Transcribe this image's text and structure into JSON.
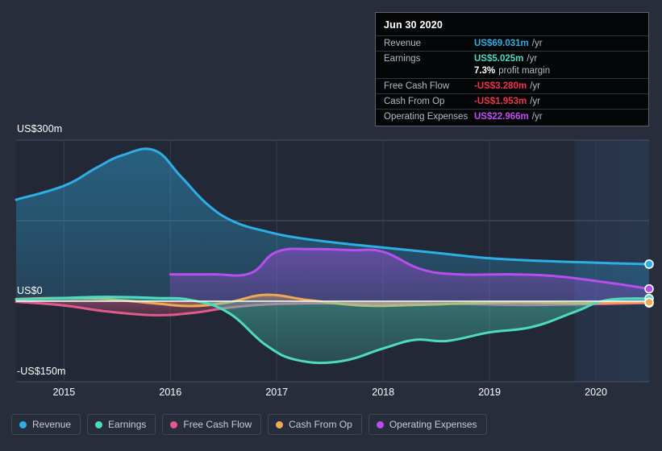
{
  "chart_data": {
    "type": "area",
    "title": "",
    "xlabel": "",
    "ylabel": "",
    "x_tick_labels": [
      "2015",
      "2016",
      "2017",
      "2018",
      "2019",
      "2020"
    ],
    "y_tick_labels": [
      "US$300m",
      "US$0",
      "-US$150m"
    ],
    "ylim": [
      -150,
      300
    ],
    "y_unit": "US$m",
    "grid": true,
    "legend_position": "bottom-left",
    "forecast_region_start": "2019.8",
    "series": [
      {
        "name": "Revenue",
        "color": "#2dafe6",
        "x": [
          2014.55,
          2015.0,
          2015.3,
          2015.55,
          2015.85,
          2016.1,
          2016.35,
          2016.6,
          2016.9,
          2017.2,
          2017.6,
          2018.0,
          2018.5,
          2019.0,
          2019.5,
          2019.8,
          2020.1,
          2020.5
        ],
        "values": [
          189,
          215,
          248,
          272,
          281,
          232,
          180,
          148,
          130,
          118,
          108,
          100,
          90,
          80,
          75,
          73,
          71,
          69.031
        ]
      },
      {
        "name": "Earnings",
        "color": "#4ddbc0",
        "x": [
          2014.55,
          2015.0,
          2015.4,
          2015.85,
          2016.2,
          2016.55,
          2016.9,
          2017.2,
          2017.6,
          2018.0,
          2018.3,
          2018.6,
          2019.0,
          2019.4,
          2019.8,
          2020.1,
          2020.5
        ],
        "values": [
          3,
          6,
          8,
          6,
          2,
          -22,
          -82,
          -110,
          -112,
          -88,
          -72,
          -74,
          -58,
          -48,
          -20,
          2,
          5.025
        ]
      },
      {
        "name": "Free Cash Flow",
        "color": "#e05a8c",
        "x": [
          2014.55,
          2015.0,
          2015.4,
          2015.85,
          2016.2,
          2016.55,
          2016.9,
          2017.3,
          2017.8,
          2018.3,
          2018.8,
          2019.3,
          2019.8,
          2020.1,
          2020.5
        ],
        "values": [
          -1,
          -8,
          -19,
          -26,
          -22,
          -12,
          -6,
          -4,
          -4,
          -4,
          -5,
          -7,
          -6,
          -5,
          -3.28
        ]
      },
      {
        "name": "Cash From Op",
        "color": "#eeaa55",
        "x": [
          2014.55,
          2015.0,
          2015.4,
          2015.85,
          2016.2,
          2016.55,
          2016.9,
          2017.3,
          2017.8,
          2018.3,
          2018.8,
          2019.3,
          2019.8,
          2020.1,
          2020.5
        ],
        "values": [
          4,
          6,
          4,
          -4,
          -9,
          -2,
          12,
          2,
          -8,
          -7,
          -4,
          -2,
          -4,
          -3,
          -1.953
        ]
      },
      {
        "name": "Operating Expenses",
        "color": "#b84df0",
        "x": [
          2016.0,
          2016.4,
          2016.75,
          2017.0,
          2017.35,
          2017.7,
          2018.0,
          2018.35,
          2018.7,
          2019.2,
          2019.6,
          2020.1,
          2020.5
        ],
        "values": [
          50,
          50,
          52,
          92,
          97,
          95,
          92,
          60,
          50,
          50,
          47,
          35,
          22.966
        ]
      }
    ]
  },
  "tooltip": {
    "date": "Jun 30 2020",
    "rows": [
      {
        "label": "Revenue",
        "value": "US$69.031m",
        "unit": "/yr",
        "color": "#2dafe6"
      },
      {
        "label": "Earnings",
        "value": "US$5.025m",
        "unit": "/yr",
        "color": "#4ddbc0"
      },
      {
        "label": "",
        "value": "7.3%",
        "unit": "profit margin",
        "color": "#ffffff"
      },
      {
        "label": "Free Cash Flow",
        "value": "-US$3.280m",
        "unit": "/yr",
        "color": "#f0324b"
      },
      {
        "label": "Cash From Op",
        "value": "-US$1.953m",
        "unit": "/yr",
        "color": "#f0324b"
      },
      {
        "label": "Operating Expenses",
        "value": "US$22.966m",
        "unit": "/yr",
        "color": "#c24df5"
      }
    ]
  },
  "legend": {
    "items": [
      {
        "label": "Revenue",
        "color": "#2dafe6"
      },
      {
        "label": "Earnings",
        "color": "#4ddbc0"
      },
      {
        "label": "Free Cash Flow",
        "color": "#e05a8c"
      },
      {
        "label": "Cash From Op",
        "color": "#eeaa55"
      },
      {
        "label": "Operating Expenses",
        "color": "#b84df0"
      }
    ]
  },
  "axis": {
    "y_top": "US$300m",
    "y_zero": "US$0",
    "y_bottom": "-US$150m",
    "x_labels": [
      "2015",
      "2016",
      "2017",
      "2018",
      "2019",
      "2020"
    ]
  }
}
